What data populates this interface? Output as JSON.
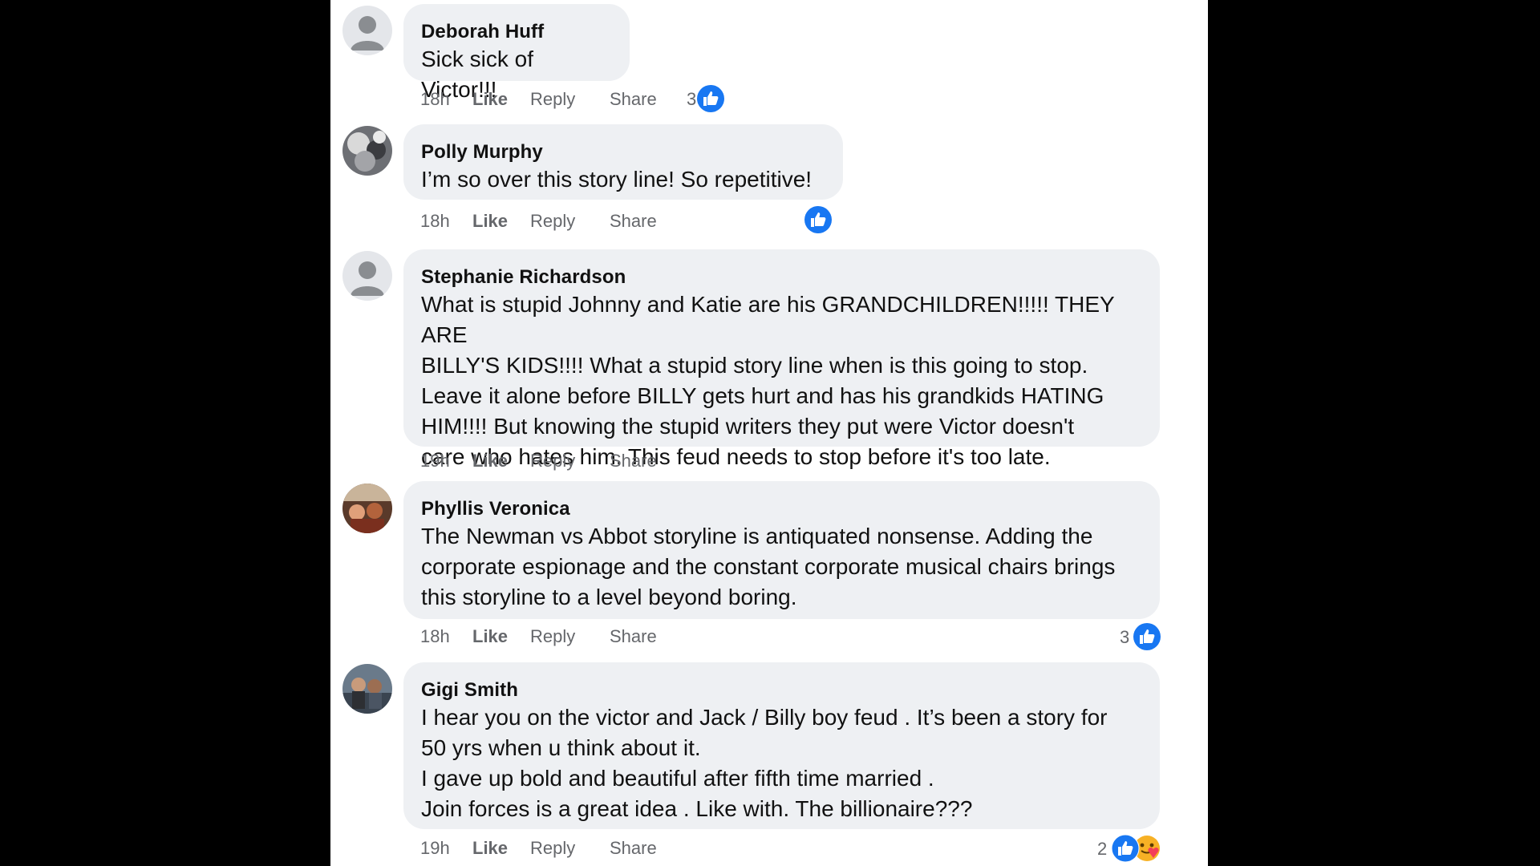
{
  "colors": {
    "accent": "#1877f2",
    "bubble": "#eef0f3",
    "meta": "#65676b",
    "background": "#000000"
  },
  "actions": {
    "like_label": "Like",
    "reply_label": "Reply",
    "share_label": "Share"
  },
  "comments": [
    {
      "author": "Deborah Huff",
      "avatar": "default-avatar",
      "lines": [
        "Sick sick of Victor!!!"
      ],
      "time": "18h",
      "reactions": {
        "count": "3",
        "icons": [
          "like-icon"
        ]
      }
    },
    {
      "author": "Polly Murphy",
      "avatar": "photo-avatar",
      "lines": [
        "I’m so over this story line! So repetitive!"
      ],
      "time": "18h",
      "reactions": {
        "count": "",
        "icons": [
          "like-icon"
        ]
      }
    },
    {
      "author": "Stephanie Richardson",
      "avatar": "default-avatar",
      "lines": [
        "What is stupid Johnny and Katie are his GRANDCHILDREN!!!!! THEY ARE",
        "BILLY'S KIDS!!!! What a stupid story line when is this going to stop.",
        "Leave it alone before BILLY gets hurt and has his grandkids HATING",
        "HIM!!!! But knowing the stupid writers they put were Victor doesn't",
        "care who hates him. This feud needs to stop before it's too late."
      ],
      "time": "19h",
      "reactions": null
    },
    {
      "author": "Phyllis Veronica",
      "avatar": "photo-avatar",
      "lines": [
        "The Newman vs Abbot storyline is antiquated nonsense. Adding the",
        "corporate espionage and the constant corporate musical chairs brings",
        "this storyline to a level beyond boring."
      ],
      "time": "18h",
      "reactions": {
        "count": "3",
        "icons": [
          "like-icon"
        ]
      }
    },
    {
      "author": "Gigi Smith",
      "avatar": "photo-avatar",
      "lines": [
        "I hear you on the victor and Jack / Billy boy feud . It’s been a story for",
        "50 yrs when u think about it.",
        "I gave up bold and beautiful after fifth time married .",
        "Join forces is a great idea . Like with. The billionaire???"
      ],
      "time": "19h",
      "reactions": {
        "count": "2",
        "icons": [
          "like-icon",
          "care-icon"
        ]
      }
    }
  ]
}
